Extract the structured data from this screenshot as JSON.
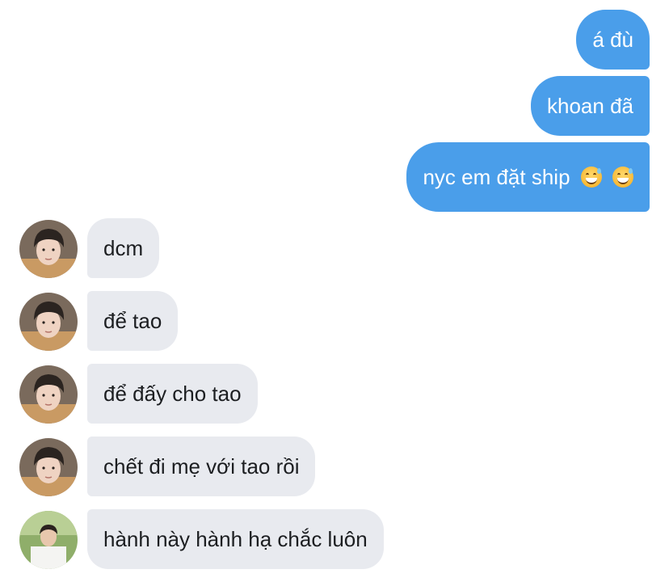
{
  "messages": {
    "sent": [
      {
        "text": "á đù"
      },
      {
        "text": "khoan đã"
      },
      {
        "text": "nyc em đặt ship"
      }
    ],
    "received": [
      {
        "text": "dcm"
      },
      {
        "text": "để tao"
      },
      {
        "text": "để đấy cho tao"
      },
      {
        "text": "chết đi mẹ với tao rồi"
      },
      {
        "text": "hành này hành hạ chắc luôn"
      }
    ]
  },
  "emoji": {
    "icon": "grinning-face-with-sweat-icon",
    "count": 2
  },
  "colors": {
    "sent_bubble": "#4a9eea",
    "received_bubble": "#e8eaef",
    "sent_text": "#ffffff",
    "received_text": "#1c1e21",
    "background": "#ffffff"
  }
}
